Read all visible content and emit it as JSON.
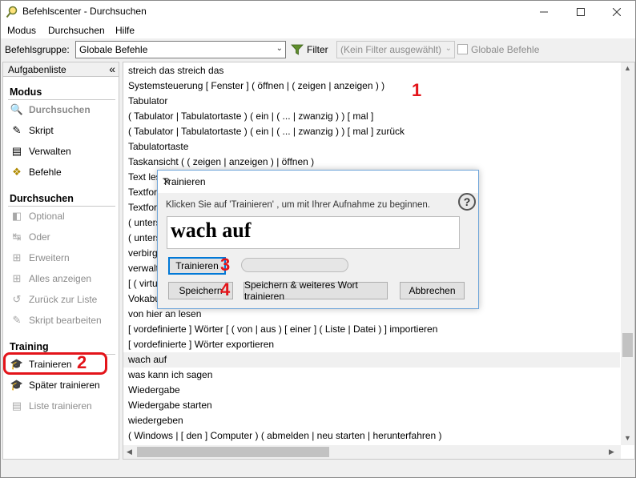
{
  "window": {
    "title": "Befehlscenter - Durchsuchen"
  },
  "menu": [
    "Modus",
    "Durchsuchen",
    "Hilfe"
  ],
  "toolbar": {
    "group_label": "Befehlsgruppe:",
    "group_value": "Globale Befehle",
    "filter_label": "Filter",
    "filter_value": "(Kein Filter ausgewählt)",
    "global_label": "Globale Befehle"
  },
  "sidebar": {
    "header": "Aufgabenliste",
    "collapse": "«",
    "sections": {
      "modus": "Modus",
      "durchsuchen": "Durchsuchen",
      "training": "Training"
    },
    "modus_items": [
      "Durchsuchen",
      "Skript",
      "Verwalten",
      "Befehle"
    ],
    "durchsuchen_items": [
      "Optional",
      "Oder",
      "Erweitern",
      "Alles anzeigen",
      "Zurück zur Liste",
      "Skript bearbeiten"
    ],
    "training_items": [
      "Trainieren",
      "Später trainieren",
      "Liste trainieren"
    ]
  },
  "commands": [
    "streich das streich das",
    "Systemsteuerung [ Fenster ] ( öffnen | ( zeigen | anzeigen ) )",
    "Tabulator",
    "( Tabulator | Tabulatortaste ) ( ein | ( ... | zwanzig ) ) [ mal ]",
    "( Tabulator | Tabulatortaste ) ( ein | ( ... | zwanzig ) ) [ mal ] zurück",
    "Tabulatortaste",
    "Taskansicht ( ( zeigen | anzeigen ) | öffnen )",
    "Text les",
    "Textforr",
    "Textforr",
    "( unters",
    "( unters",
    "verbirg",
    "verwalt",
    "[ ( virtu",
    "Vokabul",
    "von hier an lesen",
    "[ vordefinierte ] Wörter [ ( von | aus ) [ einer ] ( Liste | Datei ) ] importieren",
    "[ vordefinierte ] Wörter exportieren",
    "wach auf",
    "was kann ich sagen",
    "Wiedergabe",
    "Wiedergabe starten",
    "wiedergeben",
    "( Windows | [ den ] Computer ) ( abmelden | neu starten | herunterfahren )"
  ],
  "dialog": {
    "title": "Trainieren",
    "instruction": "Klicken Sie auf 'Trainieren' , um mit Ihrer Aufnahme zu beginnen.",
    "phrase": "wach auf",
    "train_button": "Trainieren",
    "save_button": "Speichern",
    "save_next_button": "Speichern & weiteres Wort trainieren",
    "cancel_button": "Abbrechen",
    "help": "?",
    "close": "✕"
  },
  "annotations": [
    "1",
    "2",
    "3",
    "4"
  ],
  "colors": {
    "annotation_red": "#e3141a",
    "dialog_border": "#6fa5d9",
    "default_button": "#0078d7"
  }
}
